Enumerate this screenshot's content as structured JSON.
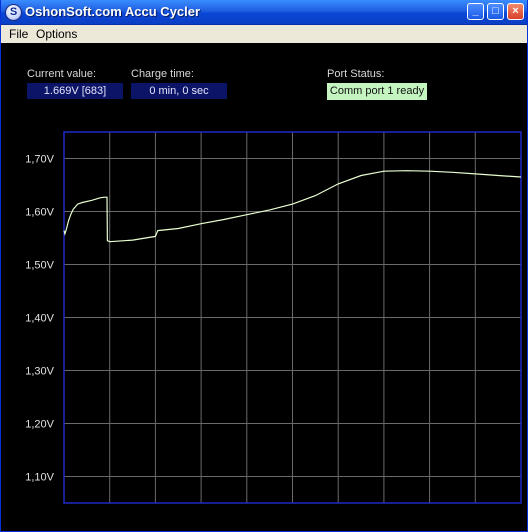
{
  "window": {
    "title": "OshonSoft.com Accu Cycler",
    "icon_letter": "S",
    "minimize_icon": "_",
    "maximize_icon": "□",
    "close_icon": "×"
  },
  "menu": [
    "File",
    "Options"
  ],
  "readouts": {
    "current_value_label": "Current value:",
    "current_value": "1.669V [683]",
    "charge_time_label": "Charge time:",
    "charge_time": "0 min, 0 sec",
    "port_status_label": "Port Status:",
    "port_status": "Comm port 1 ready"
  },
  "colors": {
    "plot_frame": "#1f28c8",
    "grid": "#6a6a6a",
    "trace": "#e8ffd0",
    "status_ok": "#c4f5c0"
  },
  "chart_data": {
    "type": "line",
    "title": "",
    "xlabel": "",
    "ylabel": "",
    "ylim": [
      1.05,
      1.75
    ],
    "yticks": [
      "1,70V",
      "1,60V",
      "1,50V",
      "1,40V",
      "1,30V",
      "1,20V",
      "1,10V"
    ],
    "grid": true,
    "x_divisions": 10,
    "series": [
      {
        "x": [
          0,
          0.02,
          0.05,
          0.1,
          0.15,
          0.2,
          0.3,
          0.4,
          0.6,
          0.8,
          0.9,
          0.94,
          0.95,
          1.0,
          1.5,
          2.0,
          2.05,
          2.5,
          3.0,
          3.5,
          4.0,
          4.5,
          5.0,
          5.5,
          6.0,
          6.5,
          7.0,
          7.5,
          8.0,
          8.5,
          9.0,
          9.5,
          10.0
        ],
        "y": [
          1.564,
          1.558,
          1.566,
          1.583,
          1.595,
          1.604,
          1.614,
          1.617,
          1.621,
          1.626,
          1.627,
          1.627,
          1.545,
          1.543,
          1.546,
          1.553,
          1.564,
          1.568,
          1.577,
          1.585,
          1.594,
          1.603,
          1.614,
          1.63,
          1.652,
          1.668,
          1.676,
          1.677,
          1.676,
          1.674,
          1.671,
          1.668,
          1.665
        ]
      }
    ]
  }
}
